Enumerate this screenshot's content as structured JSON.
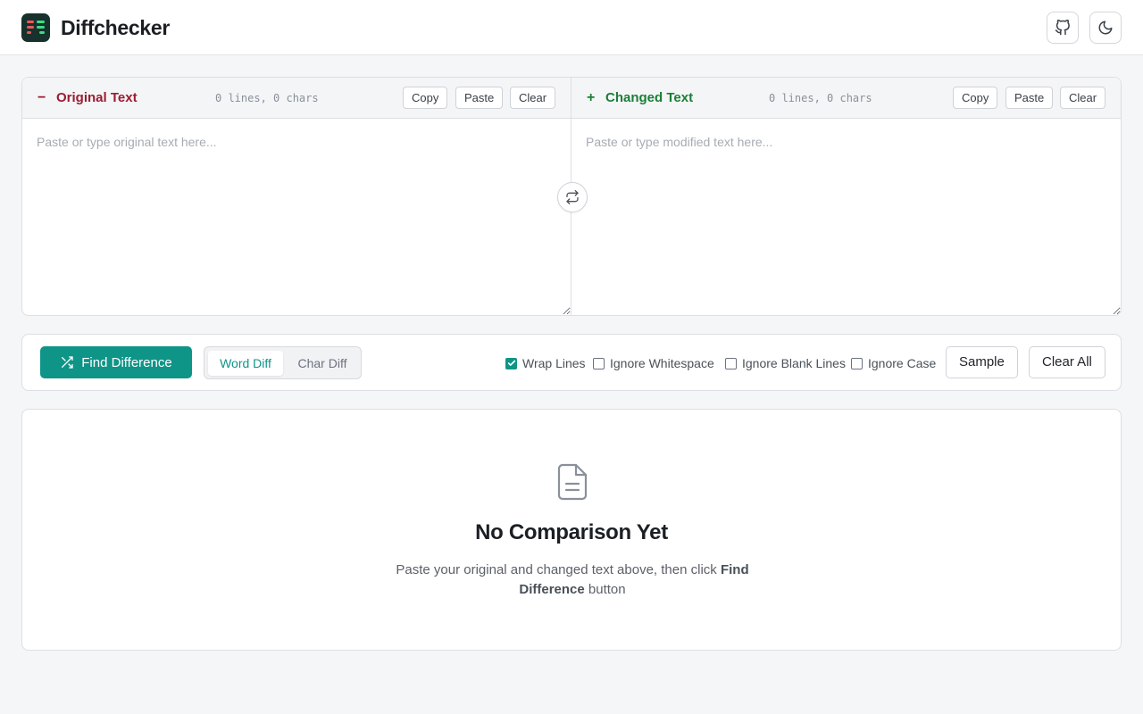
{
  "header": {
    "title": "Diffchecker",
    "github_icon": "github-icon",
    "theme_icon": "moon-icon"
  },
  "colors": {
    "accent": "#0f9488",
    "removed": "#9b1c31",
    "added": "#1a7f37"
  },
  "original": {
    "sign": "−",
    "title": "Original Text",
    "meta": "0 lines, 0 chars",
    "copy_label": "Copy",
    "paste_label": "Paste",
    "clear_label": "Clear",
    "value": "",
    "placeholder": "Paste or type original text here..."
  },
  "changed": {
    "sign": "+",
    "title": "Changed Text",
    "meta": "0 lines, 0 chars",
    "copy_label": "Copy",
    "paste_label": "Paste",
    "clear_label": "Clear",
    "value": "",
    "placeholder": "Paste or type modified text here..."
  },
  "toolbar": {
    "find_label": "Find Difference",
    "modes": [
      "Word Diff",
      "Char Diff"
    ],
    "active_mode": "Word Diff",
    "options": [
      {
        "label": "Wrap Lines",
        "checked": true
      },
      {
        "label": "Ignore Whitespace",
        "checked": false
      },
      {
        "label": "Ignore Blank Lines",
        "checked": false
      },
      {
        "label": "Ignore Case",
        "checked": false
      }
    ],
    "sample_label": "Sample",
    "clear_all_label": "Clear All"
  },
  "result": {
    "icon": "document-icon",
    "title": "No Comparison Yet",
    "desc_prefix": "Paste your original and changed text above, then click ",
    "desc_bold": "Find Difference",
    "desc_suffix": " button"
  }
}
